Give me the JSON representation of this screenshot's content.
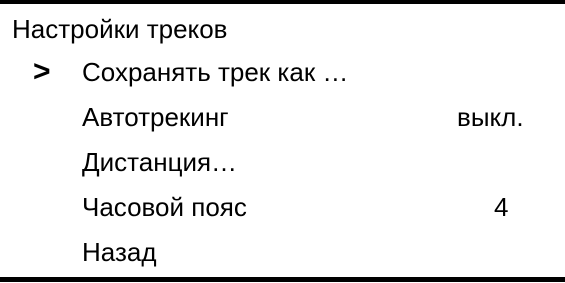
{
  "screen": {
    "title": "Настройки треков",
    "selected_indicator": ">",
    "items": [
      {
        "label": "Сохранять трек как …",
        "value": "",
        "selected": true
      },
      {
        "label": "Автотрекинг",
        "value": "выкл.",
        "selected": false
      },
      {
        "label": "Дистанция…",
        "value": "",
        "selected": false
      },
      {
        "label": "Часовой пояс",
        "value": "4",
        "selected": false
      },
      {
        "label": "Назад",
        "value": "",
        "selected": false
      }
    ]
  },
  "colors": {
    "background": "#ffffff",
    "foreground": "#000000"
  }
}
